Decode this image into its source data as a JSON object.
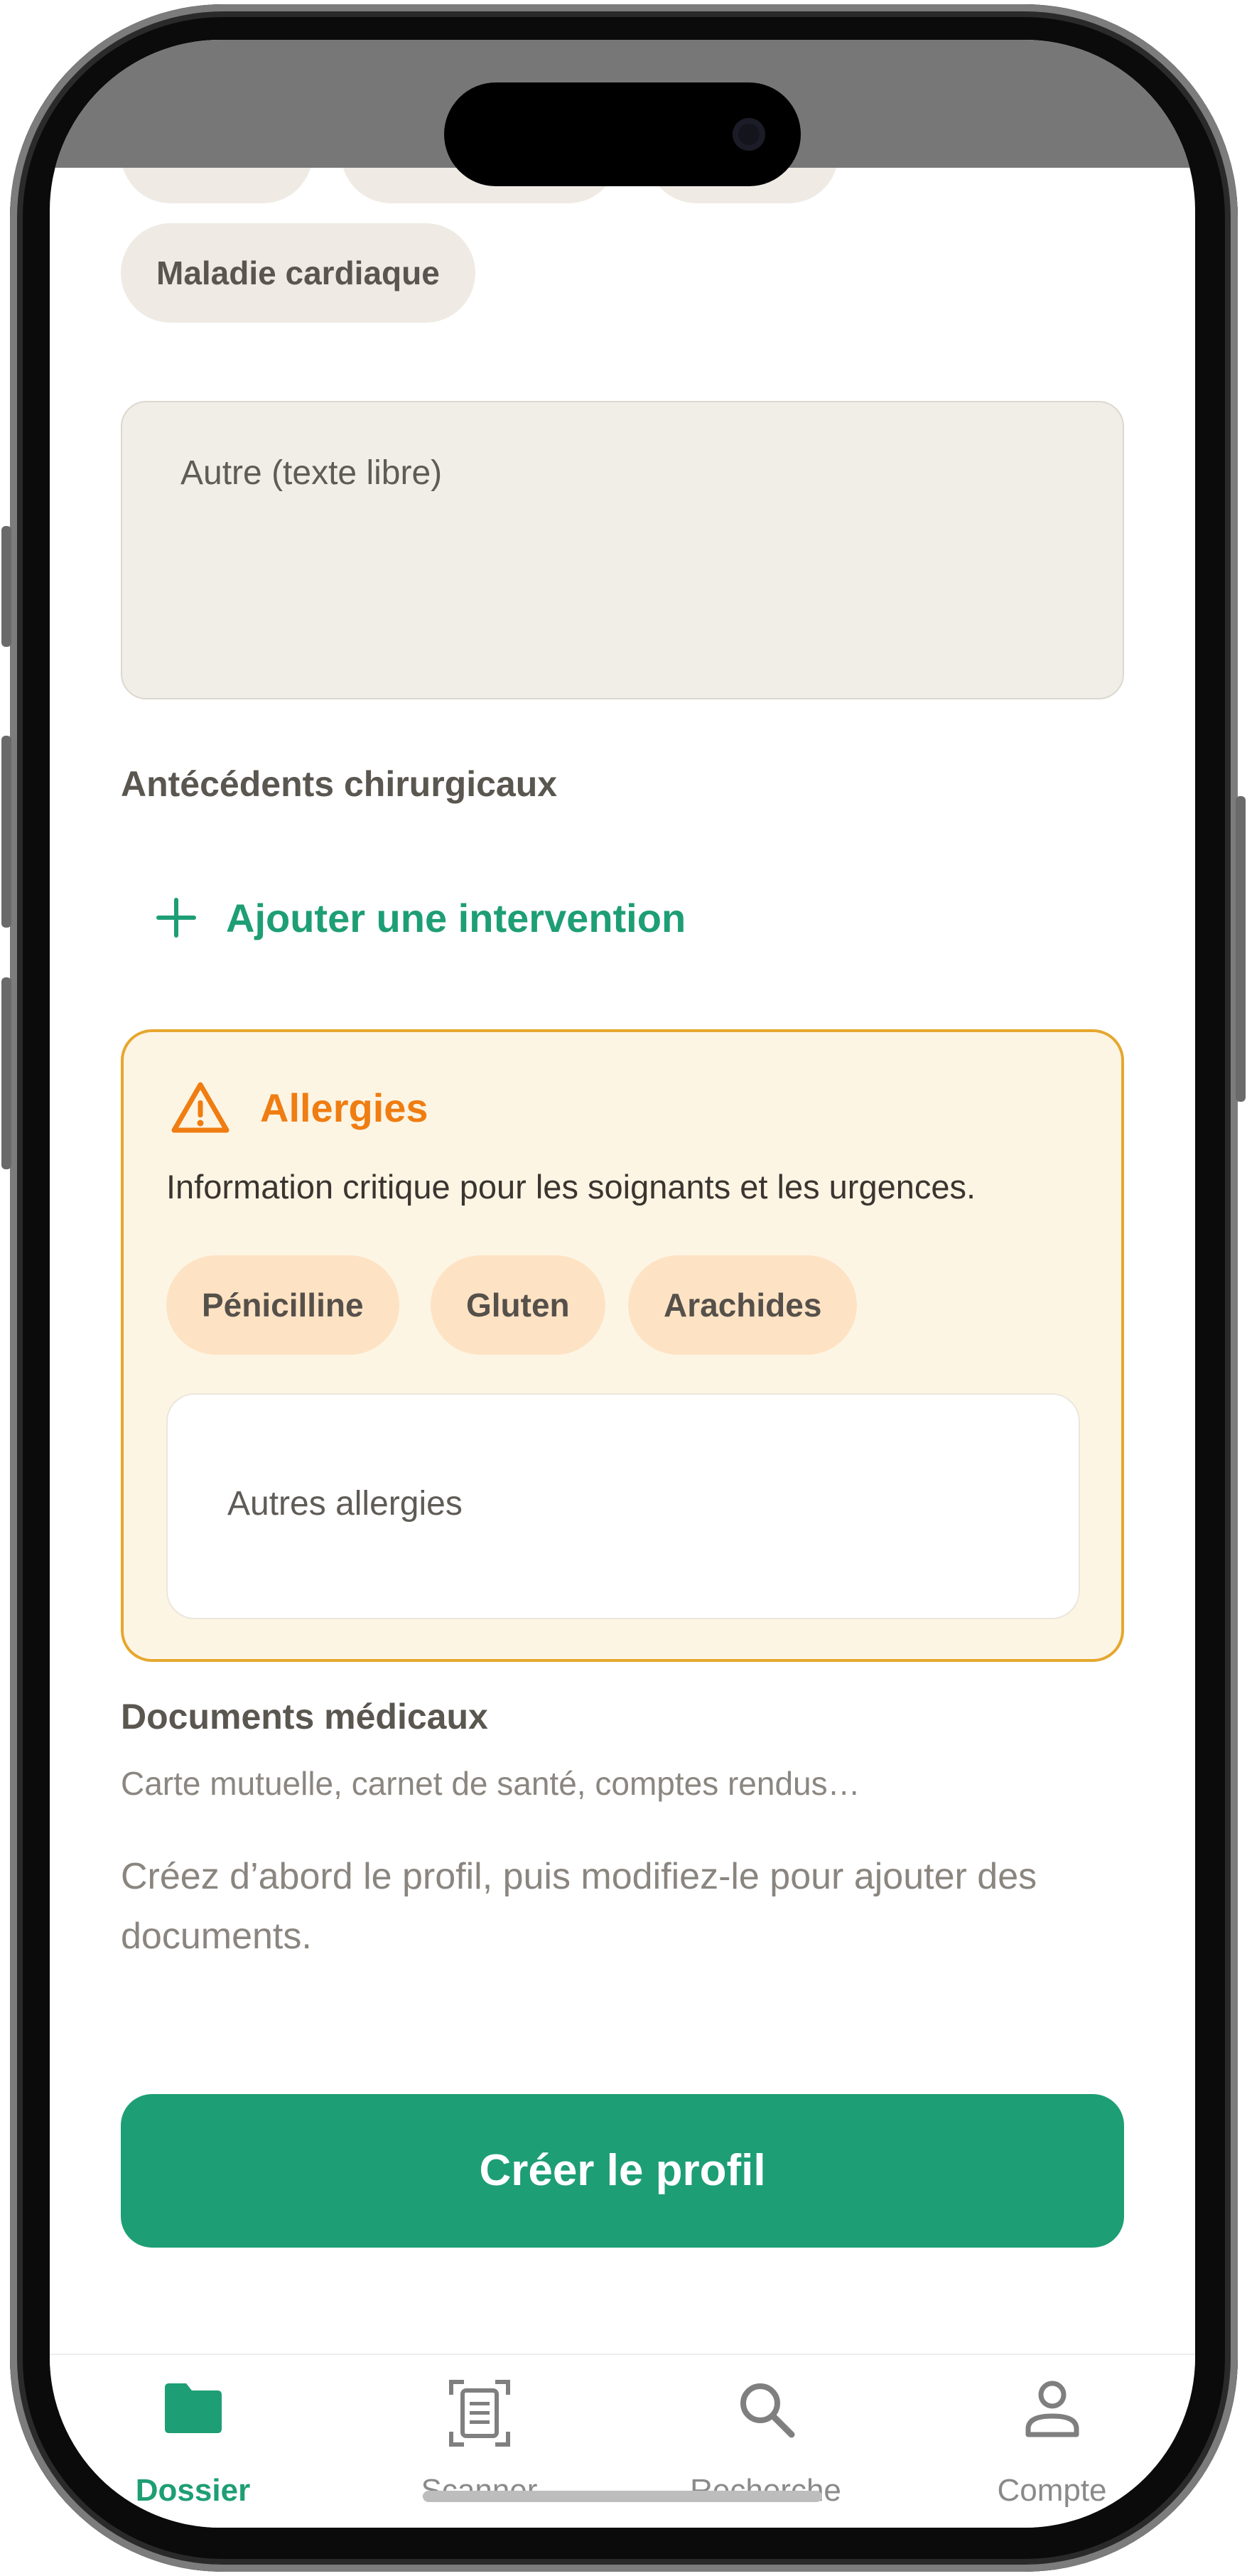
{
  "antecedents_medicaux": {
    "chips": [
      "Maladie cardiaque"
    ],
    "autre_placeholder": "Autre (texte libre)"
  },
  "antecedents_chirurgicaux": {
    "title": "Antécédents chirurgicaux",
    "add_label": "Ajouter une intervention"
  },
  "allergies": {
    "title": "Allergies",
    "description": "Information critique pour les soignants et les urgences.",
    "chips": [
      "Pénicilline",
      "Gluten",
      "Arachides"
    ],
    "other_placeholder": "Autres allergies"
  },
  "documents": {
    "title": "Documents médicaux",
    "subtitle": "Carte mutuelle, carnet de santé, comptes rendus…",
    "info": "Créez d’abord le profil, puis modifiez-le pour ajouter des documents."
  },
  "create_button": "Créer le profil",
  "tabbar": {
    "active": "Dossier",
    "tabs": [
      {
        "label": "Dossier",
        "icon": "folder-icon"
      },
      {
        "label": "Scanner",
        "icon": "scan-document-icon"
      },
      {
        "label": "Recherche",
        "icon": "search-icon"
      },
      {
        "label": "Compte",
        "icon": "user-icon"
      }
    ]
  },
  "colors": {
    "accent": "#1e9e75",
    "warning": "#ef7d12",
    "warning_border": "#e6a72e",
    "warning_bg": "#fdf5e4",
    "chip_bg": "#efebe4",
    "allergy_chip_bg": "#fde3c4"
  }
}
